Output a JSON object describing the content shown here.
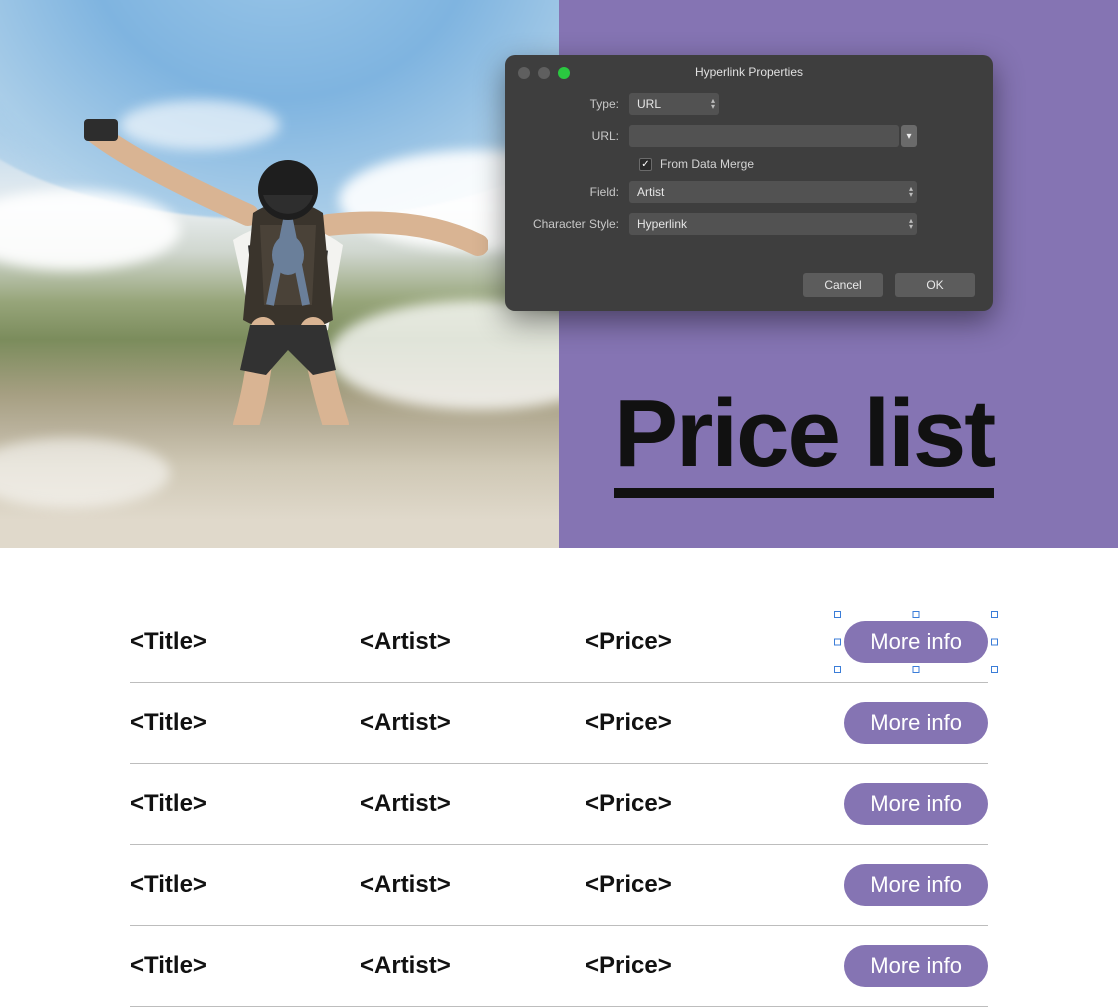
{
  "hero": {
    "title": "Price list"
  },
  "dialog": {
    "title": "Hyperlink Properties",
    "labels": {
      "type": "Type:",
      "url": "URL:",
      "from_data_merge": "From Data Merge",
      "field": "Field:",
      "char_style": "Character Style:"
    },
    "values": {
      "type": "URL",
      "url": "",
      "from_data_merge_checked": true,
      "field": "Artist",
      "char_style": "Hyperlink"
    },
    "buttons": {
      "cancel": "Cancel",
      "ok": "OK"
    }
  },
  "list": {
    "placeholders": {
      "title": "<Title>",
      "artist": "<Artist>",
      "price": "<Price>"
    },
    "button_label": "More info",
    "rows": [
      {
        "selected": true
      },
      {
        "selected": false
      },
      {
        "selected": false
      },
      {
        "selected": false
      },
      {
        "selected": false
      }
    ]
  }
}
